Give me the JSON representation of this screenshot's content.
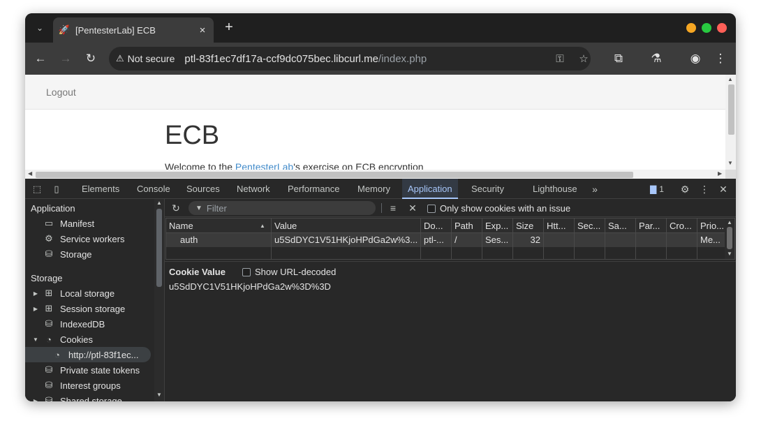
{
  "browser": {
    "tab": {
      "title": "[PentesterLab] ECB",
      "favicon": "rocket-icon"
    },
    "window_buttons": {
      "minimize_color": "#f5a623",
      "maximize_color": "#28c940",
      "close_color": "#ff5f57"
    },
    "address_bar": {
      "security_label": "Not secure",
      "url_host": "ptl-83f1ec7df17a-ccf9dc075bec.libcurl.me",
      "url_path": "/index.php"
    }
  },
  "page": {
    "nav_link": "Logout",
    "heading": "ECB",
    "welcome_prefix": "Welcome to the ",
    "welcome_link": "PentesterLab",
    "welcome_suffix": "'s exercise on ECB encryption"
  },
  "devtools": {
    "tabs": [
      "Elements",
      "Console",
      "Sources",
      "Network",
      "Performance",
      "Memory",
      "Application",
      "Security",
      "Lighthouse"
    ],
    "active_tab": "Application",
    "issues_count": "1",
    "sidebar": {
      "application_heading": "Application",
      "application_items": [
        "Manifest",
        "Service workers",
        "Storage"
      ],
      "storage_heading": "Storage",
      "storage_items": [
        "Local storage",
        "Session storage",
        "IndexedDB",
        "Cookies"
      ],
      "cookie_origin": "http://ptl-83f1ec...",
      "other_items": [
        "Private state tokens",
        "Interest groups",
        "Shared storage"
      ]
    },
    "cookies": {
      "filter_placeholder": "Filter",
      "issue_checkbox_label": "Only show cookies with an issue",
      "columns": [
        "Name",
        "Value",
        "Do...",
        "Path",
        "Exp...",
        "Size",
        "Htt...",
        "Sec...",
        "Sa...",
        "Par...",
        "Cro...",
        "Prio..."
      ],
      "row": {
        "name": "auth",
        "value": "u5SdDYC1V51HKjoHPdGa2w%3...",
        "domain": "ptl-...",
        "path": "/",
        "expires": "Ses...",
        "size": "32",
        "priority": "Me..."
      },
      "cookie_value_title": "Cookie Value",
      "decode_label": "Show URL-decoded",
      "cookie_value": "u5SdDYC1V51HKjoHPdGa2w%3D%3D"
    }
  }
}
